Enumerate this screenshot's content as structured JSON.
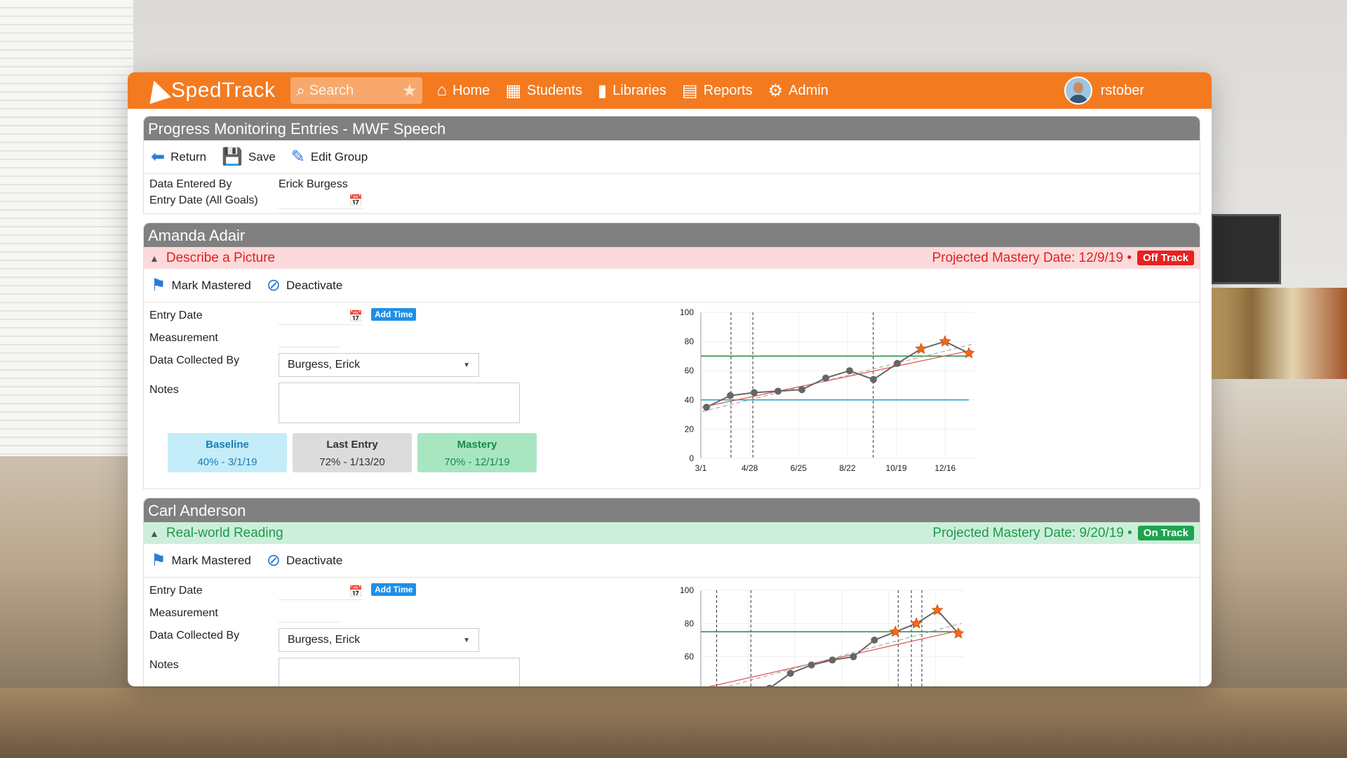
{
  "app": {
    "brand": "SpedTrack",
    "accent_color": "#f47a20",
    "search": {
      "placeholder": "Search"
    },
    "nav": [
      {
        "label": "Home",
        "icon": "home-icon"
      },
      {
        "label": "Students",
        "icon": "students-icon"
      },
      {
        "label": "Libraries",
        "icon": "libraries-icon"
      },
      {
        "label": "Reports",
        "icon": "reports-icon"
      },
      {
        "label": "Admin",
        "icon": "gear-icon"
      }
    ],
    "user": {
      "name": "rstober"
    }
  },
  "page": {
    "title": "Progress Monitoring Entries - MWF Speech",
    "toolbar": {
      "return_label": "Return",
      "save_label": "Save",
      "edit_label": "Edit Group"
    },
    "data_entered_by": {
      "label": "Data Entered By",
      "value": "Erick Burgess"
    },
    "entry_date_all": {
      "label": "Entry Date (All Goals)"
    }
  },
  "students": [
    {
      "name": "Amanda Adair",
      "goal": {
        "title": "Describe a Picture",
        "projected": "Projected Mastery Date: 12/9/19 •",
        "status": "Off Track",
        "mark_label": "Mark Mastered",
        "deactivate_label": "Deactivate",
        "entry_date_label": "Entry Date",
        "add_time_label": "Add Time",
        "measurement_label": "Measurement",
        "collected_label": "Data Collected By",
        "collected_value": "Burgess, Erick",
        "notes_label": "Notes",
        "baseline": {
          "title": "Baseline",
          "value": "40% - 3/1/19"
        },
        "last_entry": {
          "title": "Last Entry",
          "value": "72% - 1/13/20"
        },
        "mastery": {
          "title": "Mastery",
          "value": "70% - 12/1/19"
        }
      }
    },
    {
      "name": "Carl Anderson",
      "goal": {
        "title": "Real-world Reading",
        "projected": "Projected Mastery Date: 9/20/19 •",
        "status": "On Track",
        "mark_label": "Mark Mastered",
        "deactivate_label": "Deactivate",
        "entry_date_label": "Entry Date",
        "add_time_label": "Add Time",
        "measurement_label": "Measurement",
        "collected_label": "Data Collected By",
        "collected_value": "Burgess, Erick",
        "notes_label": "Notes"
      }
    }
  ],
  "chart_data": [
    {
      "type": "line",
      "yticks": [
        "0",
        "20",
        "40",
        "60",
        "80",
        "100"
      ],
      "xticks": [
        "3/1",
        "4/28",
        "6/25",
        "8/22",
        "10/19",
        "12/16"
      ],
      "ylim": [
        0,
        100
      ],
      "baseline": 40,
      "mastery": 70,
      "points": [
        35,
        43,
        45,
        46,
        47,
        55,
        60,
        54,
        65
      ],
      "mastered_points": [
        75,
        80,
        72
      ],
      "grid": true
    },
    {
      "type": "line",
      "yticks": [
        "60",
        "80",
        "100"
      ],
      "ylim": [
        40,
        100
      ],
      "mastery": 75,
      "points": [
        41,
        50,
        55,
        58,
        60,
        70
      ],
      "mastered_points": [
        75,
        80,
        88,
        74
      ],
      "grid": true
    }
  ]
}
